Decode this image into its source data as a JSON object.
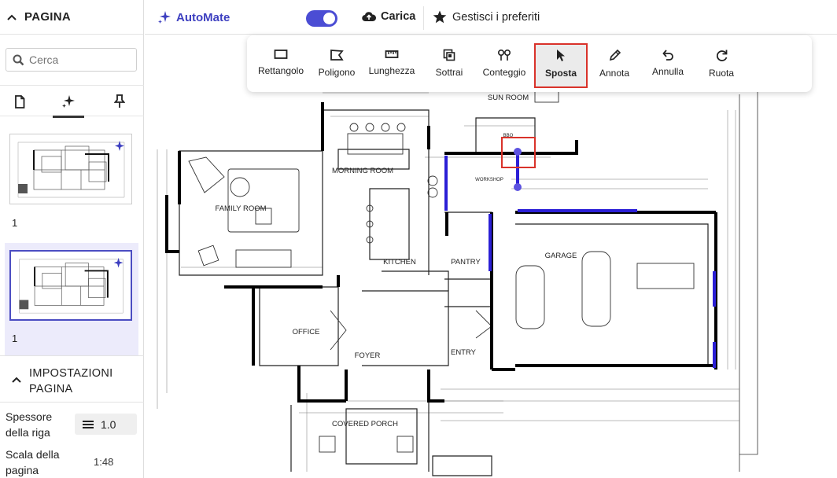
{
  "sidebar": {
    "header": "PAGINA",
    "search_placeholder": "Cerca",
    "tabs": [
      "document-icon",
      "sparkle-icon",
      "pin-icon"
    ],
    "pages": [
      {
        "number": "1"
      },
      {
        "number": "1"
      }
    ],
    "settings": {
      "title": "IMPOSTAZIONI PAGINA",
      "line_weight_label": "Spessore della riga",
      "line_weight_value": "1.0",
      "scale_label": "Scala della pagina",
      "scale_value": "1:48"
    }
  },
  "topbar": {
    "automate_label": "AutoMate",
    "automate_enabled": true,
    "upload_label": "Carica",
    "favorites_label": "Gestisci i preferiti"
  },
  "toolbar": {
    "tools": [
      {
        "label": "Rettangolo",
        "icon": "rectangle-icon"
      },
      {
        "label": "Poligono",
        "icon": "polygon-icon"
      },
      {
        "label": "Lunghezza",
        "icon": "ruler-icon"
      },
      {
        "label": "Sottrai",
        "icon": "subtract-icon"
      },
      {
        "label": "Conteggio",
        "icon": "count-icon"
      },
      {
        "label": "Sposta",
        "icon": "cursor-icon",
        "active": true
      },
      {
        "label": "Annota",
        "icon": "pen-icon"
      },
      {
        "label": "Annulla",
        "icon": "undo-icon"
      },
      {
        "label": "Ruota",
        "icon": "rotate-icon"
      }
    ]
  },
  "plan": {
    "rooms": [
      "SUN ROOM",
      "MORNING ROOM",
      "FAMILY ROOM",
      "KITCHEN",
      "PANTRY",
      "GARAGE",
      "OFFICE",
      "FOYER",
      "ENTRY",
      "COVERED PORCH",
      "WORKSHOP",
      "BBQ"
    ]
  },
  "colors": {
    "accent": "#4b4dd4",
    "highlight": "#d9322a",
    "wall_markup": "#2b1fd6"
  }
}
